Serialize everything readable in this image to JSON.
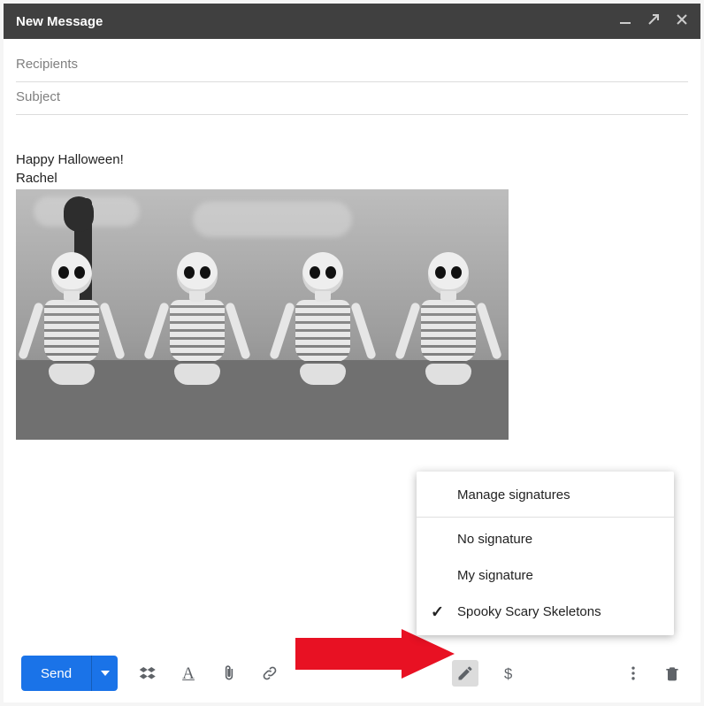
{
  "titlebar": {
    "title": "New Message"
  },
  "fields": {
    "recipients_placeholder": "Recipients",
    "subject_placeholder": "Subject"
  },
  "body": {
    "line1": "Happy Halloween!",
    "line2": "Rachel"
  },
  "signature_menu": {
    "manage": "Manage signatures",
    "items": [
      {
        "label": "No signature",
        "checked": false
      },
      {
        "label": "My signature",
        "checked": false
      },
      {
        "label": "Spooky Scary Skeletons",
        "checked": true
      }
    ]
  },
  "toolbar": {
    "send_label": "Send"
  },
  "icons": {
    "minimize": "minimize-icon",
    "popout": "popout-icon",
    "close": "close-icon",
    "dropbox": "dropbox-icon",
    "format": "format-icon",
    "attach": "attach-icon",
    "link": "link-icon",
    "signature": "pen-icon",
    "money": "dollar-icon",
    "more": "more-icon",
    "trash": "trash-icon",
    "caret": "caret-down-icon"
  }
}
